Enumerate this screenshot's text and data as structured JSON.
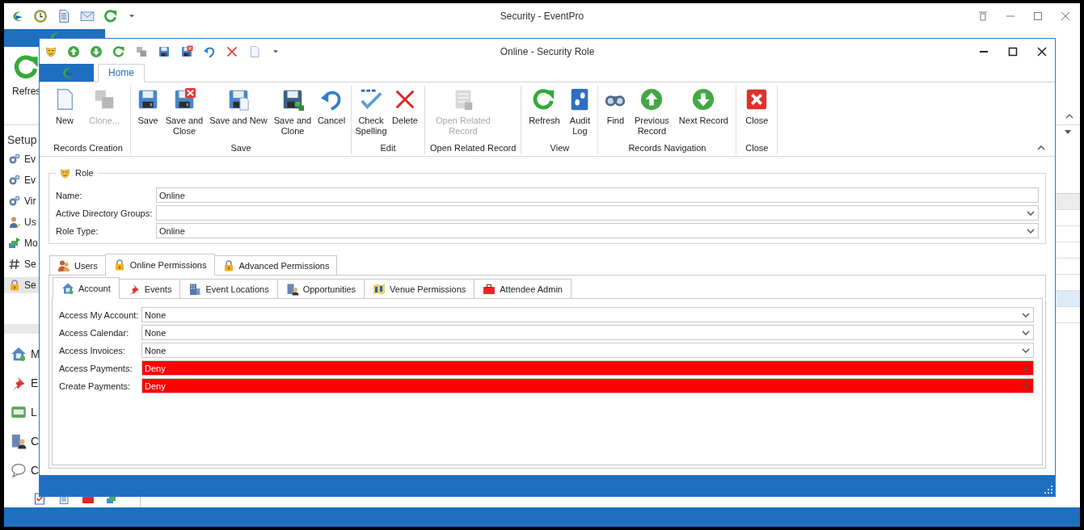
{
  "app": {
    "title": "Security - EventPro",
    "ribbon_button": "Refres",
    "sidebar": {
      "title": "Setup",
      "items": [
        {
          "label": "Ev",
          "selected": false
        },
        {
          "label": "Ev",
          "selected": false
        },
        {
          "label": "Vir",
          "selected": false
        },
        {
          "label": "Us",
          "selected": false
        },
        {
          "label": "Mo",
          "selected": false
        },
        {
          "label": "Se",
          "selected": false
        },
        {
          "label": "Se",
          "selected": true
        }
      ]
    },
    "nav": [
      "M",
      "E",
      "L",
      "C",
      "C"
    ]
  },
  "dialog": {
    "title": "Online - Security Role",
    "ribbon_tabs": [
      {
        "label": "Home",
        "selected": true
      }
    ],
    "ribbon": [
      {
        "name": "Records Creation",
        "buttons": [
          {
            "label": "New",
            "disabled": false
          },
          {
            "label": "Clone...",
            "disabled": true
          }
        ]
      },
      {
        "name": "Save",
        "buttons": [
          {
            "label": "Save",
            "disabled": false
          },
          {
            "label": "Save and Close",
            "disabled": false
          },
          {
            "label": "Save and New",
            "disabled": false
          },
          {
            "label": "Save and Clone",
            "disabled": false
          },
          {
            "label": "Cancel",
            "disabled": false
          }
        ]
      },
      {
        "name": "Edit",
        "buttons": [
          {
            "label": "Check Spelling",
            "disabled": false
          },
          {
            "label": "Delete",
            "disabled": false
          }
        ]
      },
      {
        "name": "Open Related Record",
        "buttons": [
          {
            "label": "Open Related Record",
            "disabled": true
          }
        ]
      },
      {
        "name": "View",
        "buttons": [
          {
            "label": "Refresh",
            "disabled": false
          },
          {
            "label": "Audit Log",
            "disabled": false
          }
        ]
      },
      {
        "name": "Records Navigation",
        "buttons": [
          {
            "label": "Find",
            "disabled": false
          },
          {
            "label": "Previous Record",
            "disabled": false
          },
          {
            "label": "Next Record",
            "disabled": false
          }
        ]
      },
      {
        "name": "Close",
        "buttons": [
          {
            "label": "Close",
            "disabled": false
          }
        ]
      }
    ],
    "role": {
      "legend": "Role",
      "fields": [
        {
          "label": "Name:",
          "kind": "text",
          "value": "Online"
        },
        {
          "label": "Active Directory Groups:",
          "kind": "dropdown"
        },
        {
          "label": "Role Type:",
          "kind": "dropdown",
          "value": "Online"
        }
      ]
    },
    "tabs": [
      {
        "label": "Users",
        "selected": false
      },
      {
        "label": "Online Permissions",
        "selected": true
      },
      {
        "label": "Advanced Permissions",
        "selected": false
      }
    ],
    "subtabs": [
      {
        "label": "Account",
        "selected": true
      },
      {
        "label": "Events",
        "selected": false
      },
      {
        "label": "Event Locations",
        "selected": false
      },
      {
        "label": "Opportunities",
        "selected": false
      },
      {
        "label": "Venue Permissions",
        "selected": false
      },
      {
        "label": "Attendee Admin",
        "selected": false
      }
    ],
    "permissions": [
      {
        "label": "Access My Account:",
        "value": "None",
        "denied": false
      },
      {
        "label": "Access Calendar:",
        "value": "None",
        "denied": false
      },
      {
        "label": "Access Invoices:",
        "value": "None",
        "denied": false
      },
      {
        "label": "Access Payments:",
        "value": "Deny",
        "denied": true
      },
      {
        "label": "Create Payments:",
        "value": "Deny",
        "denied": true
      }
    ]
  }
}
